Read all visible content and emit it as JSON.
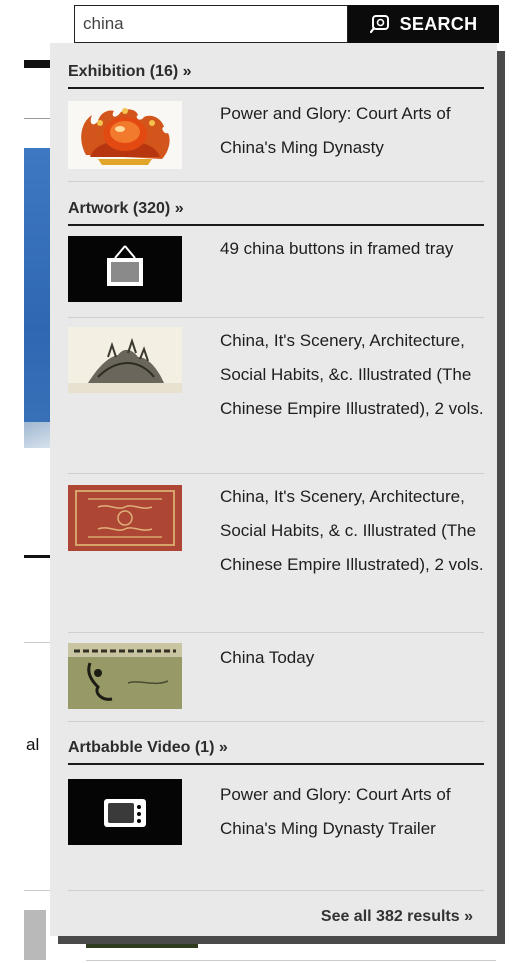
{
  "search": {
    "value": "china",
    "button_label": "SEARCH"
  },
  "background": {
    "fragment_text": "al"
  },
  "sections": [
    {
      "header": "Exhibition (16) »",
      "results": [
        {
          "title": "Power and Glory: Court Arts of China's Ming Dynasty",
          "thumb": "red-jeweled-crown-image"
        }
      ]
    },
    {
      "header": "Artwork (320) »",
      "results": [
        {
          "title": "49 china buttons in framed tray",
          "thumb": "framed-picture-icon"
        },
        {
          "title": "China, It's Scenery, Architecture, Social Habits, &c. Illustrated (The Chinese Empire Illustrated), 2 vols.",
          "thumb": "engraving-landscape-image"
        },
        {
          "title": "China, It's Scenery, Architecture, Social Habits, & c. Illustrated (The Chinese Empire Illustrated), 2 vols.",
          "thumb": "red-book-cover-image"
        },
        {
          "title": "China Today",
          "thumb": "map-book-cover-image"
        }
      ]
    },
    {
      "header": "Artbabble Video (1) »",
      "results": [
        {
          "title": "Power and Glory: Court Arts of China's Ming Dynasty Trailer",
          "thumb": "television-icon"
        }
      ]
    }
  ],
  "see_all": "See all 382 results »",
  "colors": {
    "dropdown_bg": "#e9e9e9",
    "button_bg": "#0b0b0b",
    "shadow": "#4a4a4a"
  }
}
